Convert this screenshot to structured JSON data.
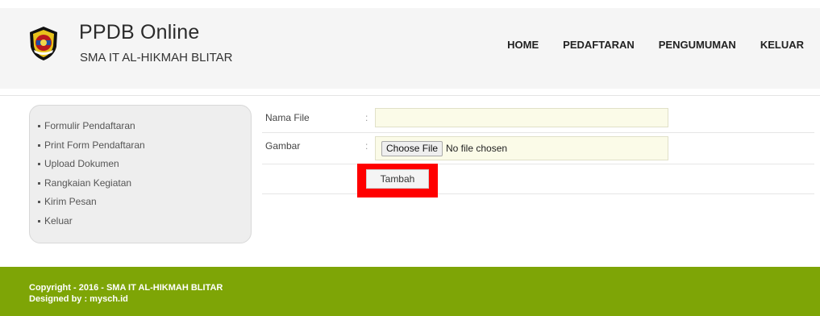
{
  "header": {
    "title": "PPDB Online",
    "subtitle": "SMA IT AL-HIKMAH BLITAR",
    "nav": [
      "HOME",
      "PEDAFTARAN",
      "PENGUMUMAN",
      "KELUAR"
    ]
  },
  "sidebar": {
    "items": [
      {
        "label": "Formulir Pendaftaran"
      },
      {
        "label": "Print Form Pendaftaran"
      },
      {
        "label": "Upload Dokumen"
      },
      {
        "label": "Rangkaian Kegiatan"
      },
      {
        "label": "Kirim Pesan"
      },
      {
        "label": "Keluar"
      }
    ]
  },
  "form": {
    "nama_file_label": "Nama File",
    "nama_file_value": "",
    "gambar_label": "Gambar",
    "colon": ":",
    "choose_file_label": "Choose File",
    "no_file_text": "No file chosen",
    "submit_label": "Tambah"
  },
  "footer": {
    "copyright": "Copyright - 2016 - SMA IT AL-HIKMAH BLITAR",
    "designed": "Designed by : mysch.id"
  },
  "colors": {
    "footer_bg": "#7ea506",
    "highlight": "#ff0000",
    "input_bg": "#fbfbe8"
  }
}
